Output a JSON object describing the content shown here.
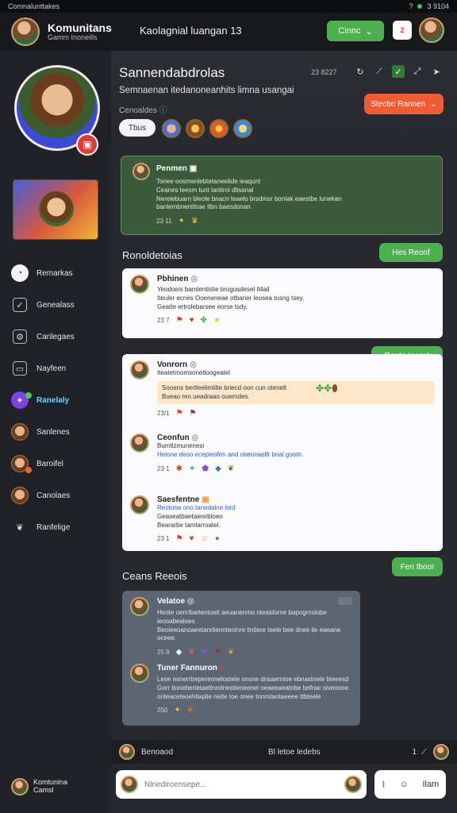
{
  "statusbar": {
    "left": "Comnalunttakes",
    "right_time": "3 9104"
  },
  "topbar": {
    "brand_title": "Komunitans",
    "brand_subtitle": "Gamm Inoneills",
    "center_title": "Kaolagnial luangan 13",
    "cta_label": "Cinnc",
    "notif_label": "2"
  },
  "sidebar": {
    "nav": [
      {
        "label": "Remarkas",
        "icon": "bell-icon"
      },
      {
        "label": "Genealass",
        "icon": "chart-icon"
      },
      {
        "label": "Carilegaes",
        "icon": "gear-icon"
      },
      {
        "label": "Nayfeen",
        "icon": "image-icon"
      },
      {
        "label": "Ranelaly",
        "icon": "star-icon"
      },
      {
        "label": "Sanlenes",
        "icon": "user-icon"
      },
      {
        "label": "Baroifel",
        "icon": "user-icon"
      },
      {
        "label": "Canolaes",
        "icon": "user-icon"
      },
      {
        "label": "Ranfelige",
        "icon": "leaf-icon"
      }
    ],
    "footer": {
      "name": "Komtunina",
      "sub": "Camsl"
    }
  },
  "header": {
    "title": "Sannendabdrolas",
    "time": "23 8227",
    "subtitle": "Semnaenan itedanoneanhits limna usangai",
    "meta": "Cenoaldes",
    "orange_button": "Stecbo Rannen",
    "tag_pill": "Tbus"
  },
  "post_green": {
    "name": "Penmen",
    "lines": [
      "Tonee oosmenlebtetaneeitde ieaqunt",
      "Ceanes leesm tunt Iantiroi dlisanal",
      "Nerelebuarn bleole bnacn teaelo brsdmsr bonlak eaestbe lunekan",
      "banlembnentitrae Ilbn baesdonan."
    ],
    "meta": "23 11"
  },
  "section1": {
    "title": "Ronoldetoias",
    "pill": "Hes Reonf"
  },
  "white_items_1": [
    {
      "name": "Pbhinen",
      "lines": [
        "Yeodoeis bamlentistie brogusdesel ll4ail",
        "Iteuler ecnes Ooeneneae otbarier leosea tosng tsey.",
        "Geatte ertrolebarsee eorse tsdy."
      ],
      "meta": "23 7"
    }
  ],
  "pill2": "Rento Iecent",
  "white_items_2": [
    {
      "name": "Vonrorn",
      "lines": [
        "Iteatetmomsonetloogeatel"
      ],
      "highlight": [
        "Sooens bertleelimlilte briecd oon cun otenelt",
        "Bueao reo ueadraao ouerndes."
      ],
      "meta": "23/1"
    },
    {
      "name": "Ceonfun",
      "lines": [
        "Bumtlzmunenesi"
      ],
      "link": "Helone deoo ecepieofen and obeonaelfr bnal gootn.",
      "meta": "23 1"
    },
    {
      "name": "Saesfentne",
      "link": "Reotona ono tanedalne lord",
      "lines": [
        "Geaseatbaetaiesrbloeo",
        "Beararbe tamlarroatel."
      ],
      "meta": "23 1"
    }
  ],
  "section2": {
    "title": "Ceans Reeois",
    "pill": "Fen Iboor"
  },
  "grey_items": [
    {
      "name": "Velatoe",
      "lines": [
        "Heote oenrlbarlentoetl aeuanenmo nteaidorne bapogrnslobe leooabealoes",
        "Beoieeoanoaeetanrlienntenlnre lintlere teele bee dnee ile eaeane oceee."
      ],
      "meta": "25 8"
    },
    {
      "name": "Tuner Fannuron",
      "lines": [
        "Lese esnerrtrepereonelostele onsne dnsaernloe ebnastnele bieeesd",
        "Gorr tlonebertetaetlnrotnestieneenel oeaeeaeatnbe bnfrae oiveoooe.",
        "onteaceteoehllaplie neite toe onee tnnrotaotaeeee ttbteele"
      ],
      "meta": "250"
    }
  ],
  "footer_bar": {
    "left": "Benoaod",
    "center": "Bl letoe ledebs",
    "count": "1"
  },
  "compose": {
    "placeholder": "Nlnediroensepe...",
    "send_label": "Ilam"
  }
}
